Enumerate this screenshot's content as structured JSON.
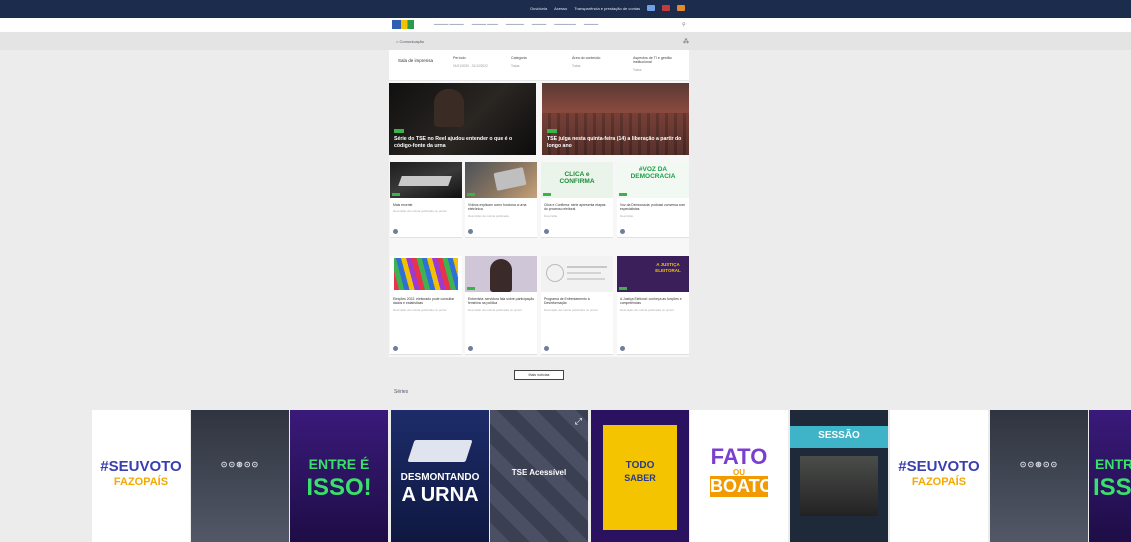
{
  "topbar": {
    "links": [
      "Ouvidoria",
      "Acesso",
      "Transparência e prestação de contas"
    ]
  },
  "breadcrumb": {
    "label": "Comunicação"
  },
  "filters": {
    "title": "Sala de imprensa",
    "columns": [
      {
        "label": "Período",
        "value": "01/01/2020 - 31/12/2022"
      },
      {
        "label": "Categoria",
        "value": "Todas"
      },
      {
        "label": "Área do conteúdo",
        "value": "Todas"
      },
      {
        "label": "Aspectos de TI e gestão institucional",
        "value": "Todos"
      }
    ]
  },
  "hero": [
    {
      "caption": "Série do TSE no Reel ajudou entender o que é o código-fonte da urna"
    },
    {
      "caption": "TSE julga nesta quinta-feira (14) a liberação a partir do longo ano"
    }
  ],
  "cards_row1": [
    {
      "title": "Mais recente",
      "desc": "Descrição da notícia publicada no portal"
    },
    {
      "title": "Vídeos explicam como funciona a urna eletrônica",
      "desc": "Descrição da notícia publicada"
    },
    {
      "title": "Clica e Confirma: série apresenta etapas do processo eleitoral",
      "desc": "Descrição"
    },
    {
      "title": "Voz da Democracia: podcast conversa com especialistas",
      "desc": "Descrição"
    }
  ],
  "cards_row2": [
    {
      "title": "Eleições 2022: eleitorado pode consultar dados e estatísticas",
      "desc": "Descrição da notícia publicada no portal"
    },
    {
      "title": "Entrevista: servidora fala sobre participação feminina na política",
      "desc": "Descrição da notícia publicada no portal"
    },
    {
      "title": "Programa de Enfrentamento à Desinformação",
      "desc": "Descrição da notícia publicada no portal"
    },
    {
      "title": "A Justiça Eleitoral: conheça as funções e competências",
      "desc": "Descrição da notícia publicada no portal"
    }
  ],
  "card_img": {
    "c3": "CLICA e CONFIRMA",
    "c4": "#VOZ DA DEMOCRACIA",
    "c8": "A JUSTIÇA ELEITORAL"
  },
  "more_button": "Mais notícias",
  "section_title": "Séries",
  "strip": {
    "seuvoto_a": "#SEUVOTO",
    "seuvoto_b": "FAZOPAÍS",
    "entre": "ENTRE É",
    "isso": "ISSO!",
    "desmontando": "DESMONTANDO",
    "urna": "A URNA",
    "acessivel": "TSE Acessível",
    "todo": "TODO",
    "saber": "SABER",
    "fato": "FATO",
    "ou": "OU",
    "boato": "BOATO",
    "sessao": "SESSÃO"
  },
  "colors": {
    "navy": "#1c2c4c",
    "green": "#3bb34a",
    "purple": "#3b1f7a",
    "yellow": "#f5c400"
  }
}
